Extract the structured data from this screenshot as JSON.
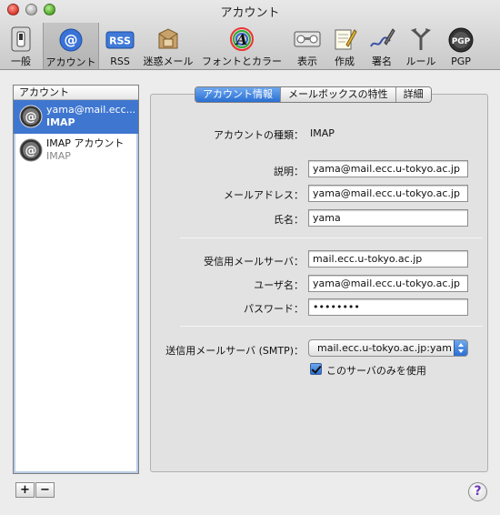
{
  "window": {
    "title": "アカウント"
  },
  "toolbar": {
    "items": [
      {
        "label": "一般",
        "icon": "switch-icon"
      },
      {
        "label": "アカウント",
        "icon": "at-icon"
      },
      {
        "label": "RSS",
        "icon": "rss-icon"
      },
      {
        "label": "迷惑メール",
        "icon": "junk-mail-icon"
      },
      {
        "label": "フォントとカラー",
        "icon": "font-color-icon"
      },
      {
        "label": "表示",
        "icon": "display-icon"
      },
      {
        "label": "作成",
        "icon": "compose-icon"
      },
      {
        "label": "署名",
        "icon": "signature-icon"
      },
      {
        "label": "ルール",
        "icon": "rules-icon"
      },
      {
        "label": "PGP",
        "icon": "pgp-icon"
      }
    ],
    "rss_badge": "RSS",
    "pgp_badge": "PGP"
  },
  "sidebar": {
    "header": "アカウント",
    "accounts": [
      {
        "name": "yama@mail.ecc....",
        "type": "IMAP"
      },
      {
        "name": "IMAP アカウント",
        "type": "IMAP"
      }
    ],
    "add_label": "+",
    "remove_label": "−"
  },
  "tabs": [
    {
      "label": "アカウント情報"
    },
    {
      "label": "メールボックスの特性"
    },
    {
      "label": "詳細"
    }
  ],
  "form": {
    "account_type_label": "アカウントの種類：",
    "account_type_value": "IMAP",
    "description_label": "説明：",
    "description_value": "yama@mail.ecc.u-tokyo.ac.jp",
    "email_label": "メールアドレス：",
    "email_value": "yama@mail.ecc.u-tokyo.ac.jp",
    "fullname_label": "氏名：",
    "fullname_value": "yama",
    "incoming_server_label": "受信用メールサーバ：",
    "incoming_server_value": "mail.ecc.u-tokyo.ac.jp",
    "username_label": "ユーザ名：",
    "username_value": "yama@mail.ecc.u-tokyo.ac.jp",
    "password_label": "パスワード：",
    "password_value": "••••••••",
    "smtp_label": "送信用メールサーバ (SMTP)：",
    "smtp_value": "mail.ecc.u-tokyo.ac.jp:yam",
    "only_this_server_label": "このサーバのみを使用",
    "only_this_server_checked": true
  },
  "help": {
    "label": "?"
  },
  "colors": {
    "selection": "#3f76d0",
    "accent": "#2a6fd3"
  }
}
